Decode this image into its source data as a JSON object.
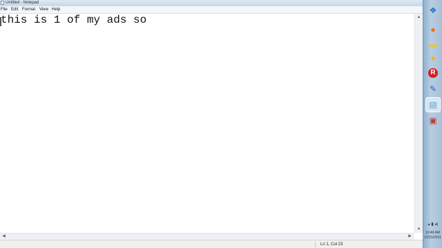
{
  "window": {
    "title": "Untitled - Notepad",
    "menus": [
      "File",
      "Edit",
      "Format",
      "View",
      "Help"
    ]
  },
  "editor": {
    "text": "this is 1 of my ads so"
  },
  "statusbar": {
    "position": "Ln 1, Col 23"
  },
  "taskbar": {
    "items": [
      {
        "icon": "windows-start-icon",
        "glyph": "❖",
        "color": "#1d6fd0"
      },
      {
        "icon": "firefox-icon",
        "glyph": "●",
        "color": "#e8701a"
      },
      {
        "icon": "folder-icon",
        "glyph": "▬",
        "color": "#e7c24f"
      },
      {
        "icon": "tool-app-icon",
        "glyph": "✦",
        "color": "#f0b400"
      },
      {
        "icon": "roblox-icon",
        "glyph": "R",
        "color": "#d21f1f"
      },
      {
        "icon": "paint-app-icon",
        "glyph": "✎",
        "color": "#2b63c8"
      },
      {
        "icon": "notepad-icon",
        "glyph": "▤",
        "color": "#4aa0d8"
      },
      {
        "icon": "document-app-icon",
        "glyph": "▣",
        "color": "#b53d3d"
      }
    ],
    "tray_glyphs": "▴ ▮ ◂)",
    "time": "10:49 AM",
    "date": "12/21/2011"
  },
  "colors": {
    "taskbar": "#a7c0d8",
    "window_bg": "#ffffff",
    "titlebar": "#d4e1ee"
  }
}
